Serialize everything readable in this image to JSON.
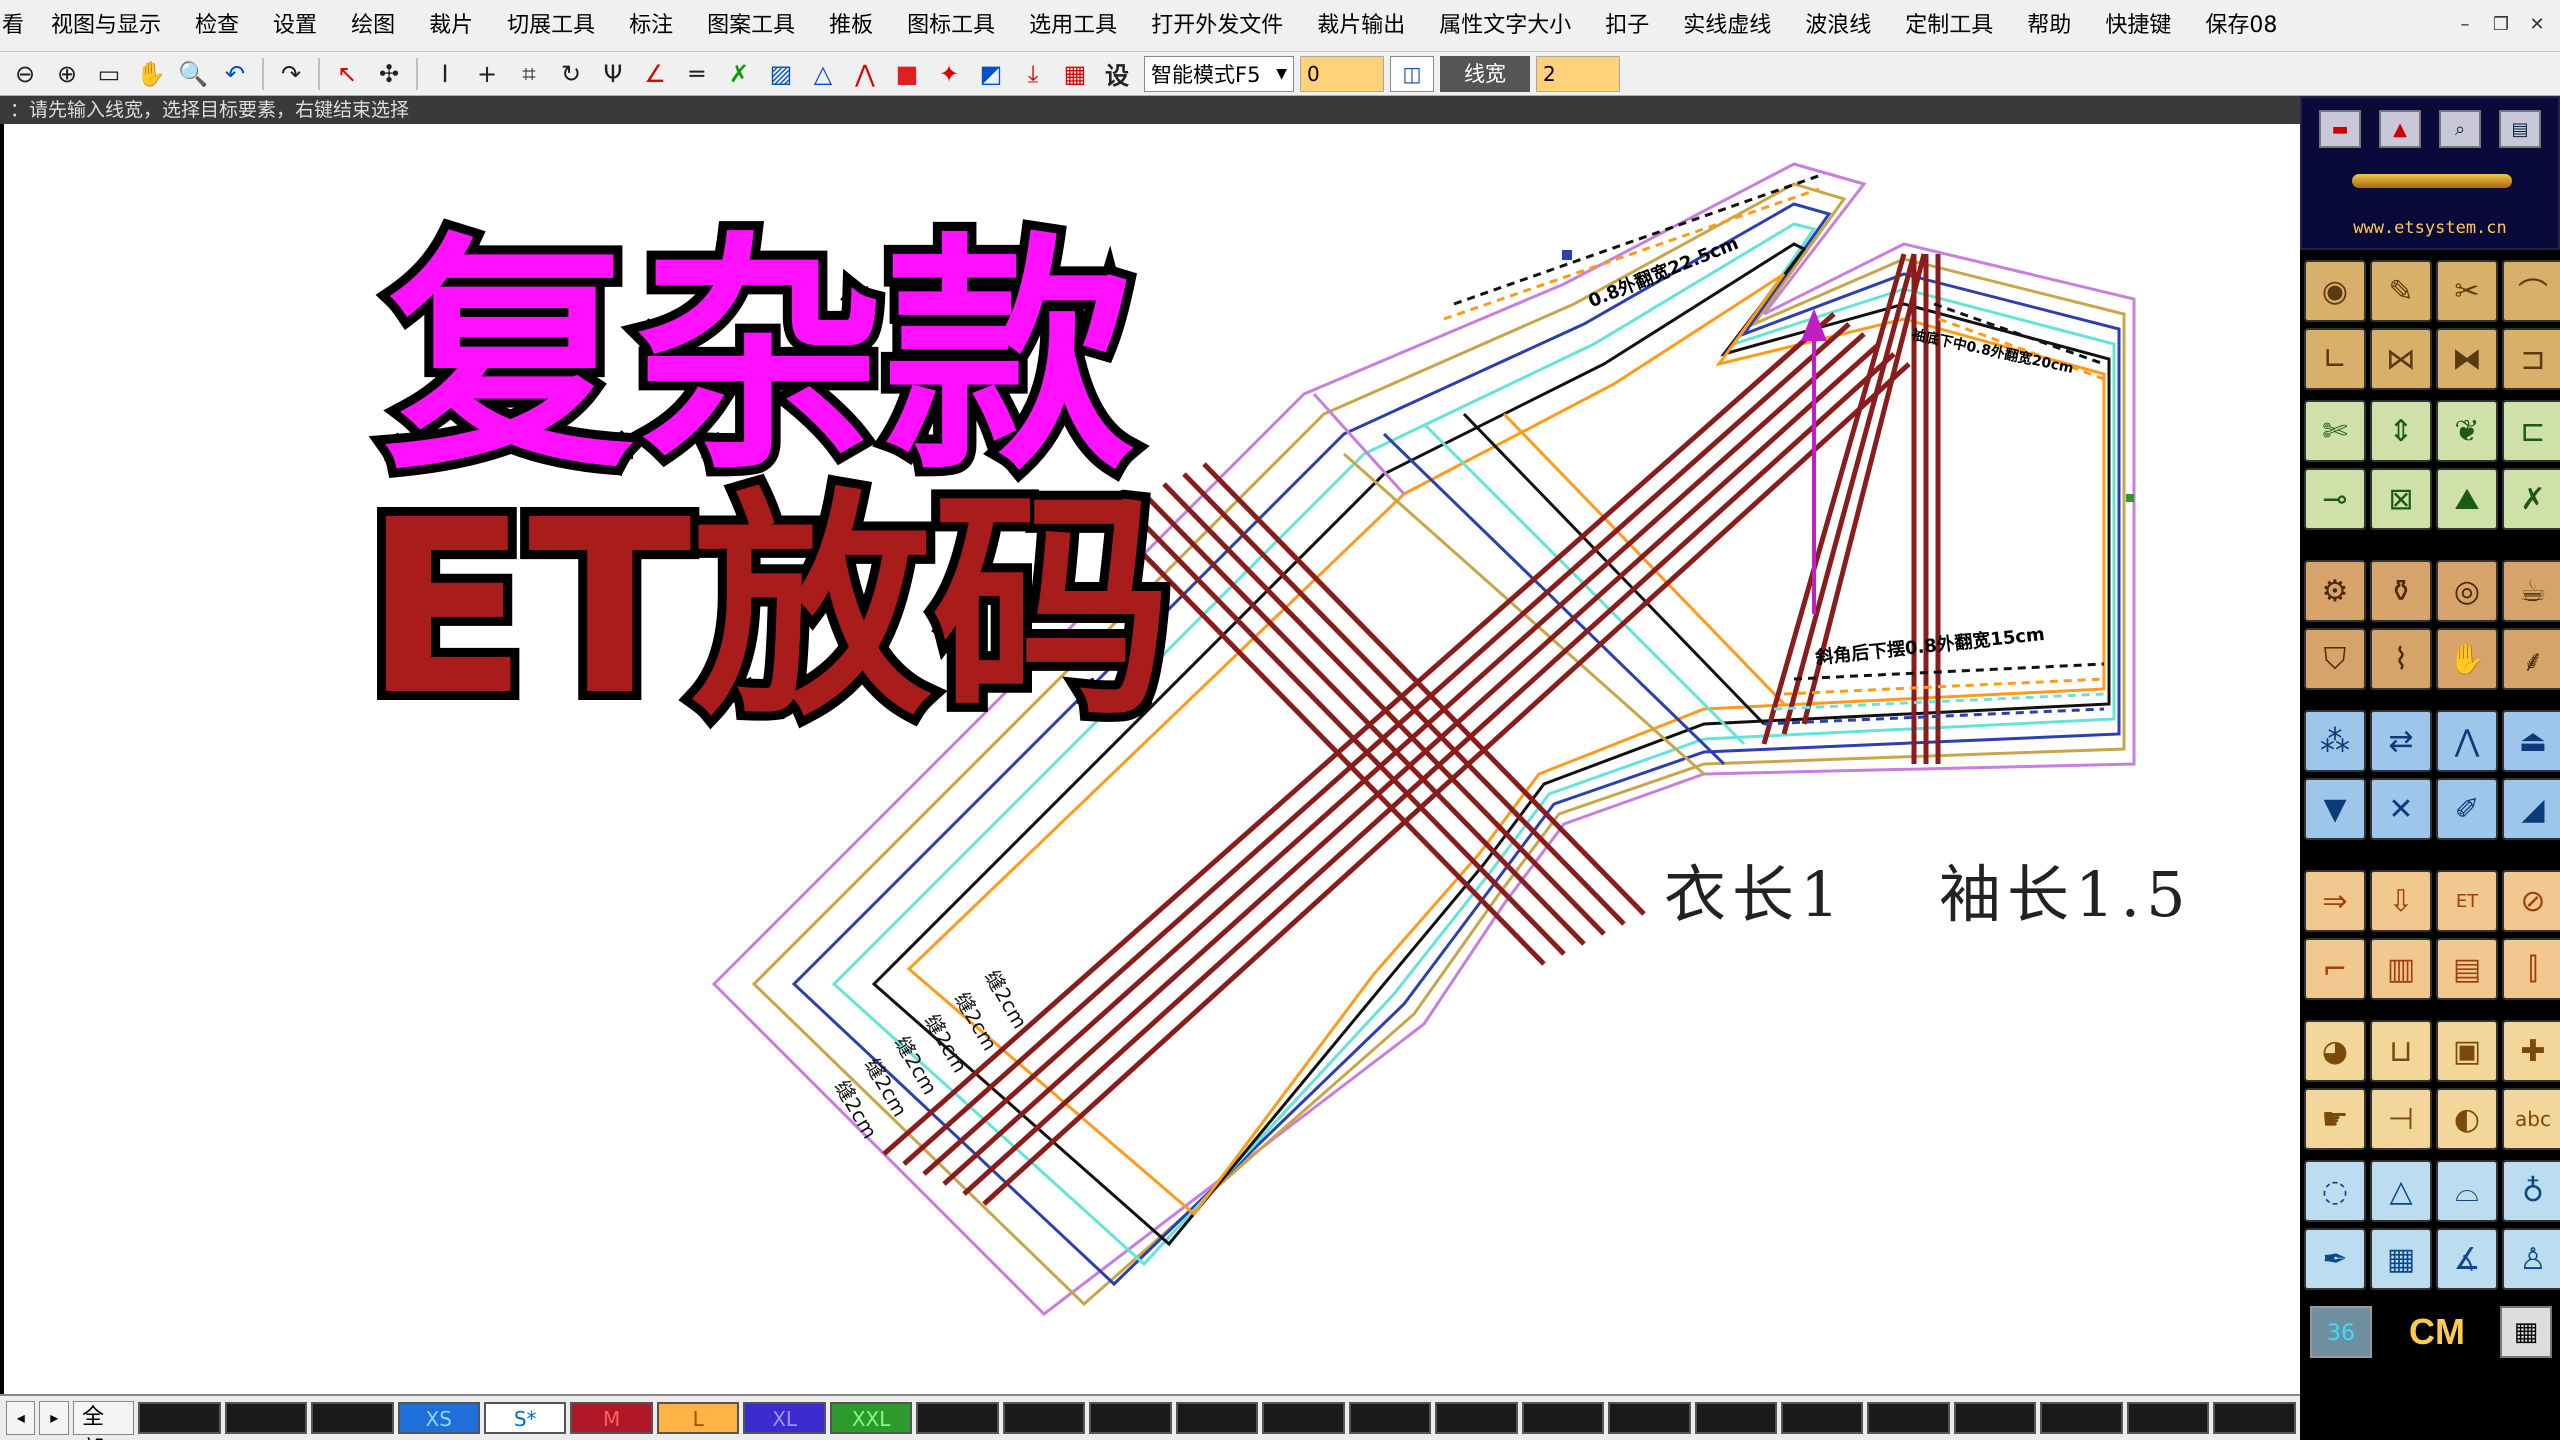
{
  "menu": {
    "items": [
      "视图与显示",
      "检查",
      "设置",
      "绘图",
      "裁片",
      "切展工具",
      "标注",
      "图案工具",
      "推板",
      "图标工具",
      "选用工具",
      "打开外发文件",
      "裁片输出",
      "属性文字大小",
      "扣子",
      "实线虚线",
      "波浪线",
      "定制工具",
      "帮助",
      "快捷键",
      "保存08"
    ],
    "first_fragment": "看"
  },
  "toolbar": {
    "mode_select": "智能模式F5",
    "value_input": "0",
    "line_width_label": "线宽",
    "line_width_value": "2",
    "settings_glyph": "设"
  },
  "prompt": {
    "text": "：请先输入线宽，选择目标要素，右键结束选择"
  },
  "overlay": {
    "title_line1": "复杂款",
    "title_line2": "ET放码"
  },
  "canvas": {
    "note_body": "衣长1",
    "note_sleeve": "袖长1.5",
    "annotation_top": "0.8外翻宽22.5cm",
    "annotation_mid": "袖底下中0.8外翻宽20cm",
    "annotation_bottom": "斜角后下摆0.8外翻宽15cm",
    "seam_labels": [
      "缝2cm",
      "缝2cm",
      "缝2cm",
      "缝2cm",
      "缝2cm",
      "缝2cm"
    ]
  },
  "panel": {
    "url": "www.etsystem.cn",
    "size_value": "36",
    "unit": "CM"
  },
  "size_bar": {
    "all_label": "全部",
    "sizes": [
      {
        "label": "XS",
        "bg": "#1e6fd9",
        "fg": "#8fd4ff"
      },
      {
        "label": "S*",
        "bg": "#ffffff",
        "fg": "#0070c0"
      },
      {
        "label": "M",
        "bg": "#b01828",
        "fg": "#ff6060"
      },
      {
        "label": "L",
        "bg": "#ffb347",
        "fg": "#a05000"
      },
      {
        "label": "XL",
        "bg": "#3a2ad0",
        "fg": "#a090ff"
      },
      {
        "label": "XXL",
        "bg": "#2e9a2e",
        "fg": "#80ff80"
      }
    ]
  },
  "colors": {
    "title_magenta": "#ff10ff",
    "title_darkred": "#a81c1c",
    "grade_lines": [
      "#c77ee0",
      "#c9a54a",
      "#2b3fb0",
      "#64e4d6",
      "#111111",
      "#ff9a1a"
    ],
    "grain_line": "#8a1c1c"
  }
}
